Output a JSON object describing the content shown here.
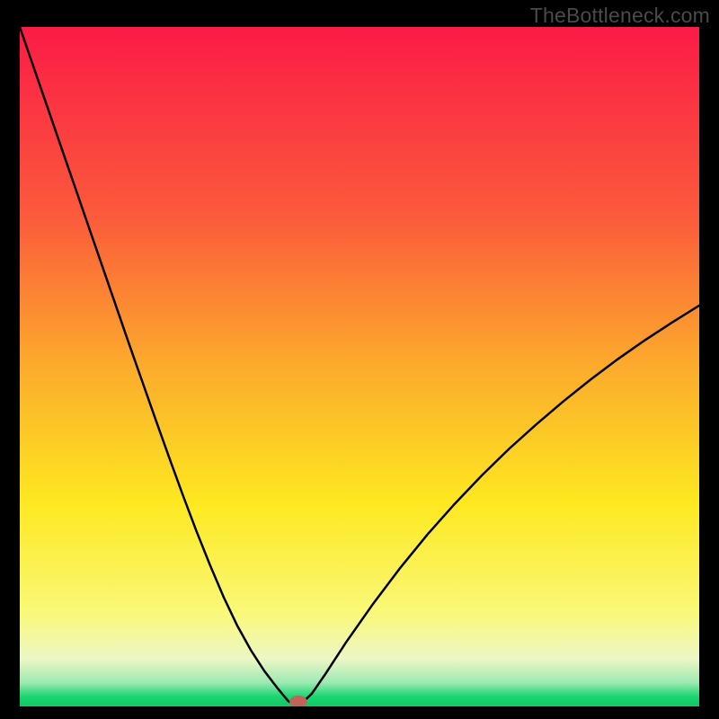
{
  "watermark": "TheBottleneck.com",
  "chart_data": {
    "type": "line",
    "title": "",
    "xlabel": "",
    "ylabel": "",
    "xlim": [
      0,
      100
    ],
    "ylim": [
      0,
      100
    ],
    "background_gradient": {
      "stops": [
        {
          "offset": 0.0,
          "color": "#fb1b47"
        },
        {
          "offset": 0.28,
          "color": "#fb5b3b"
        },
        {
          "offset": 0.5,
          "color": "#fcab2c"
        },
        {
          "offset": 0.7,
          "color": "#fde820"
        },
        {
          "offset": 0.86,
          "color": "#faf877"
        },
        {
          "offset": 0.93,
          "color": "#ecf7c5"
        },
        {
          "offset": 0.965,
          "color": "#9de9b3"
        },
        {
          "offset": 0.985,
          "color": "#1bd771"
        },
        {
          "offset": 1.0,
          "color": "#13c566"
        }
      ]
    },
    "series": [
      {
        "name": "bottleneck-curve",
        "color": "#000000",
        "x": [
          0,
          2,
          4,
          6,
          8,
          10,
          12,
          14,
          16,
          18,
          20,
          22,
          24,
          26,
          28,
          30,
          32,
          34,
          36,
          38,
          39.5,
          41,
          43,
          45,
          48,
          52,
          56,
          60,
          64,
          68,
          72,
          76,
          80,
          84,
          88,
          92,
          96,
          100
        ],
        "y": [
          100,
          94.2,
          88.4,
          82.6,
          76.8,
          71.0,
          65.2,
          59.4,
          53.6,
          47.9,
          42.2,
          36.6,
          31.1,
          25.8,
          20.8,
          16.1,
          11.9,
          8.3,
          5.2,
          2.6,
          0.8,
          0.0,
          1.9,
          4.8,
          9.4,
          15.1,
          20.4,
          25.3,
          29.8,
          34.0,
          37.9,
          41.5,
          44.9,
          48.1,
          51.1,
          53.9,
          56.5,
          59.0
        ]
      }
    ],
    "marker": {
      "name": "optimal-point",
      "x": 41.0,
      "y": 0.7,
      "rx": 1.3,
      "ry": 0.9,
      "color": "#c0645a"
    }
  }
}
